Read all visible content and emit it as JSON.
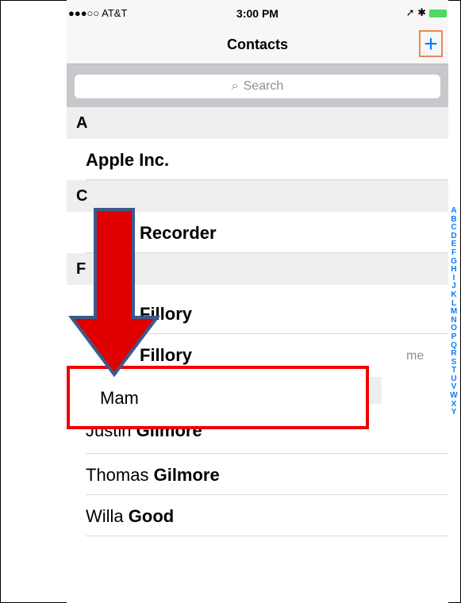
{
  "statusbar": {
    "carrier": "●●●○○ AT&T",
    "time": "3:00 PM",
    "right": "➚ ✱"
  },
  "navbar": {
    "title": "Contacts",
    "add": "+"
  },
  "search": {
    "placeholder": "Search"
  },
  "sections": [
    {
      "letter": "A",
      "rows": [
        "Apple Inc."
      ]
    },
    {
      "letter": "C",
      "rows": [
        "Call Recorder"
      ]
    },
    {
      "letter": "F",
      "rows": [
        "J Fillory",
        "M Fillory"
      ]
    }
  ],
  "visible_rows": {
    "apple": "Apple Inc.",
    "call": "Recorder",
    "c_prefix": "C",
    "fillory1": "Fillory",
    "fillory2": "Fillory",
    "f_letter": "F",
    "justin_first": "Justin ",
    "justin_last": "Gilmore",
    "thomas_first": "Thomas ",
    "thomas_last": "Gilmore",
    "willa_first": "Willa ",
    "willa_last": "Good"
  },
  "new_contact": {
    "name": "Mam",
    "hint": "me"
  },
  "index_letters": [
    "A",
    "B",
    "C",
    "D",
    "E",
    "F",
    "G",
    "H",
    "I",
    "J",
    "K",
    "L",
    "M",
    "N",
    "O",
    "P",
    "Q",
    "R",
    "S",
    "T",
    "U",
    "V",
    "W",
    "X",
    "Y"
  ],
  "colors": {
    "accent": "#0a7aff",
    "highlight": "#e00000",
    "arrow": "#e00000",
    "arrow_border": "#3b5a8a"
  }
}
